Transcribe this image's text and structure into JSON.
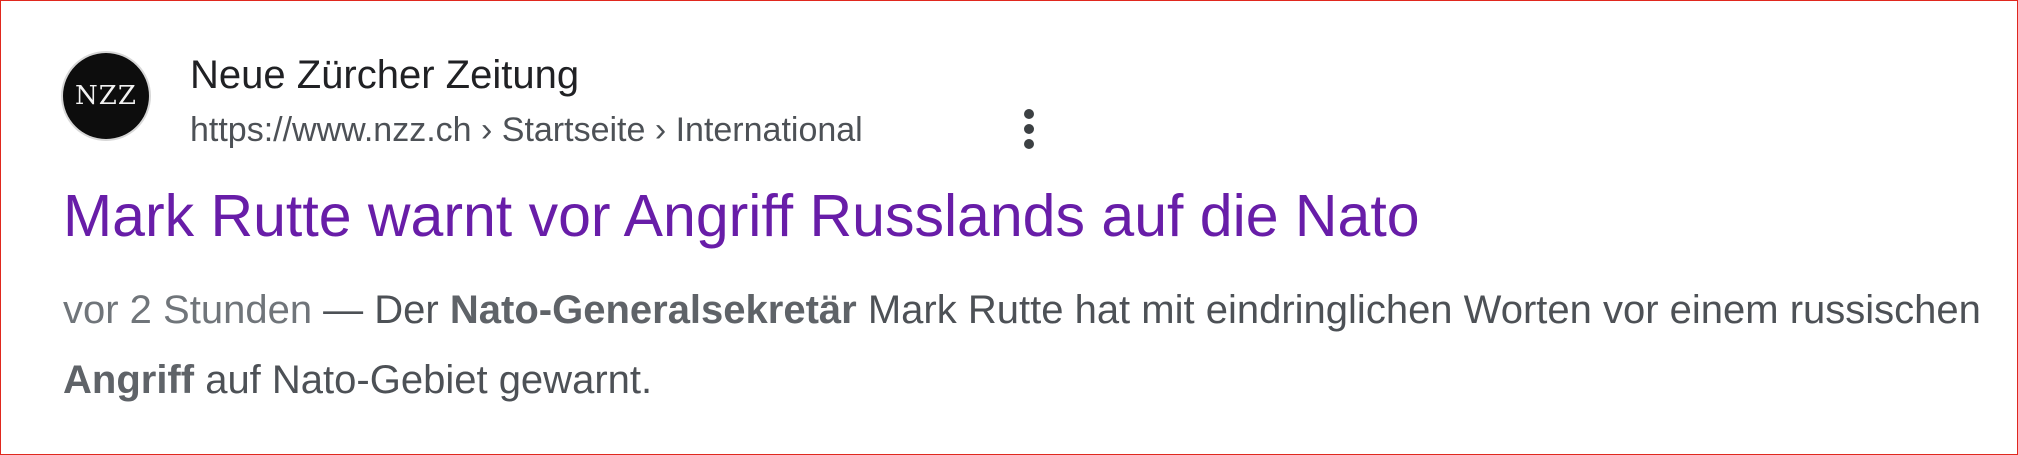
{
  "result": {
    "source": {
      "favicon_text": "NZZ",
      "site_name": "Neue Zürcher Zeitung",
      "url": "https://www.nzz.ch › Startseite › International",
      "more_icon": "three-dots-vertical-icon"
    },
    "title": "Mark Rutte warnt vor Angriff Russlands auf die Nato",
    "snippet": {
      "date": "vor 2 Stunden",
      "separator": " — ",
      "segments": [
        {
          "text": "Der ",
          "bold": false
        },
        {
          "text": "Nato-Generalsekretär",
          "bold": true
        },
        {
          "text": " Mark Rutte hat mit eindringlichen Worten vor einem russischen ",
          "bold": false
        },
        {
          "text": "Angriff",
          "bold": true
        },
        {
          "text": " auf Nato-Gebiet gewarnt.",
          "bold": false
        }
      ]
    }
  },
  "colors": {
    "title_visited": "#681da8",
    "frame_border": "#e0281e",
    "text_primary": "#202124",
    "text_secondary": "#4d5156"
  }
}
